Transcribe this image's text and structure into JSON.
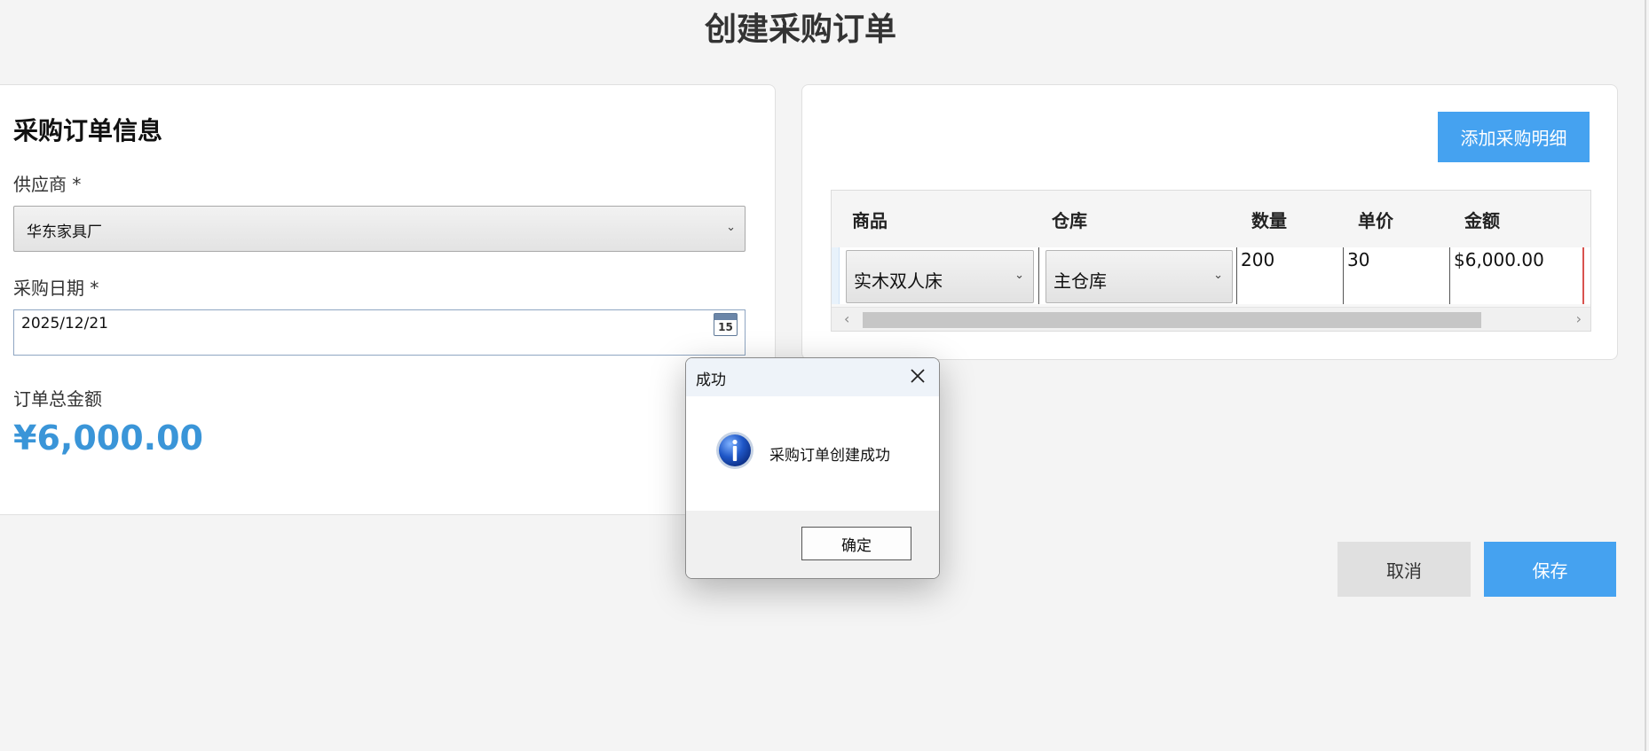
{
  "page_title": "创建采购订单",
  "order_info": {
    "title": "采购订单信息",
    "supplier_label": "供应商 *",
    "supplier_value": "华东家具厂",
    "date_label": "采购日期 *",
    "date_value": "2025/12/21",
    "calendar_day": "15",
    "total_label": "订单总金额",
    "total_value": "¥6,000.00"
  },
  "details": {
    "add_button": "添加采购明细",
    "columns": [
      "商品",
      "仓库",
      "数量",
      "单价",
      "金额"
    ],
    "rows": [
      {
        "product": "实木双人床",
        "warehouse": "主仓库",
        "quantity": "200",
        "unit_price": "30",
        "amount": "$6,000.00"
      }
    ],
    "scroll_left": "‹",
    "scroll_right": "›"
  },
  "actions": {
    "cancel": "取消",
    "save": "保存"
  },
  "dialog": {
    "title": "成功",
    "message": "采购订单创建成功",
    "ok": "确定"
  },
  "colors": {
    "accent": "#45a2f0",
    "total": "#3a95d8"
  },
  "icons": {
    "calendar": "calendar-icon",
    "info": "info-icon",
    "close": "close-icon",
    "chevron": "chevron-down-icon"
  }
}
